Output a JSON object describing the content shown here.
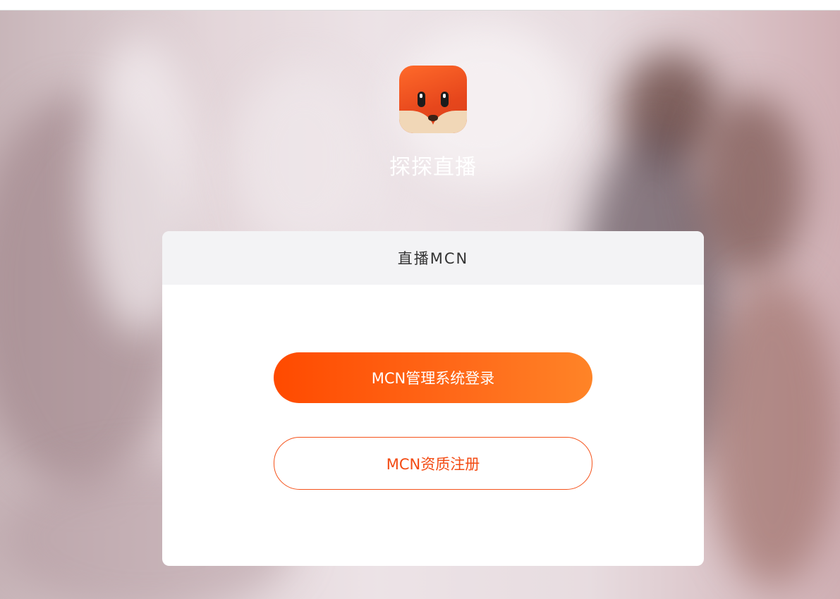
{
  "app": {
    "name": "探探直播",
    "logo_icon": "fox-logo-icon"
  },
  "card": {
    "title": "直播MCN"
  },
  "buttons": {
    "login_label": "MCN管理系统登录",
    "register_label": "MCN资质注册"
  },
  "colors": {
    "accent": "#ff5a0f",
    "accent_gradient_end": "#ff8427",
    "card_header_bg": "#f3f3f5"
  }
}
